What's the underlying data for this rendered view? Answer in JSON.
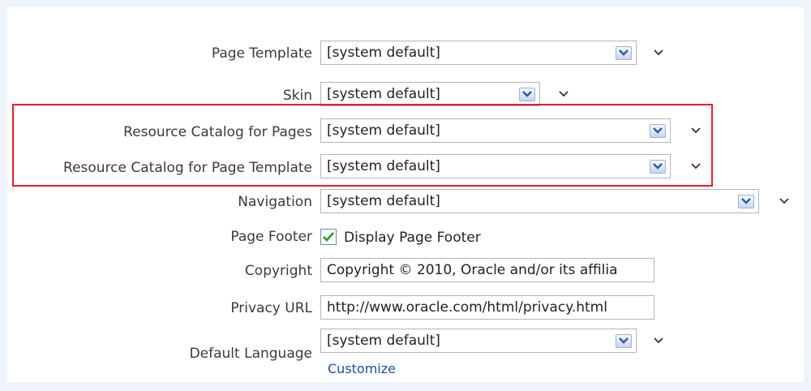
{
  "fields": {
    "page_template": {
      "label": "Page Template",
      "value": "[system default]"
    },
    "skin": {
      "label": "Skin",
      "value": "[system default]"
    },
    "catalog_pages": {
      "label": "Resource Catalog for Pages",
      "value": "[system default]"
    },
    "catalog_page_template": {
      "label": "Resource Catalog for Page Template",
      "value": "[system default]"
    },
    "navigation": {
      "label": "Navigation",
      "value": "[system default]"
    },
    "page_footer": {
      "label": "Page Footer",
      "checkbox_label": "Display Page Footer",
      "checked": true
    },
    "copyright": {
      "label": "Copyright",
      "value": "Copyright © 2010, Oracle and/or its affilia"
    },
    "privacy_url": {
      "label": "Privacy URL",
      "value": "http://www.oracle.com/html/privacy.html"
    },
    "default_language": {
      "label": "Default Language",
      "value": "[system default]",
      "customize_link": "Customize"
    }
  },
  "colors": {
    "highlight_border": "#e4202a",
    "link": "#1a4f9c",
    "check": "#2e9b2e"
  },
  "icons": {
    "dropdown": "chevron-down-icon",
    "checkbox": "checkmark-icon"
  }
}
